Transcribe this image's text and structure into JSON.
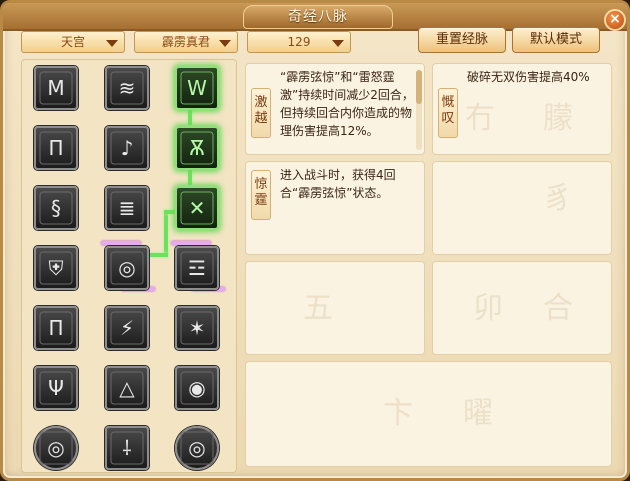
{
  "window": {
    "title": "奇经八脉",
    "close_label": "×"
  },
  "filters": {
    "faction": "天宫",
    "school": "霹雳真君",
    "level": "129"
  },
  "buttons": {
    "reset": "重置经脉",
    "default": "默认模式"
  },
  "skills": [
    {
      "name": "激越",
      "desc": "“霹雳弦惊”和“雷怒霆激”持续时间减少2回合，但持续回合内你造成的物理伤害提高12%。"
    },
    {
      "name": "慨叹",
      "desc": "破碎无双伤害提高40%"
    },
    {
      "name": "惊霆",
      "desc": "进入战斗时，获得4回合“霹雳弦惊”状态。"
    }
  ],
  "colors": {
    "accent": "#b98a45",
    "active_glow": "#6ed95a",
    "chain": "#e6a9f2"
  },
  "icons": [
    "lightning-icon",
    "cloud-icon",
    "claw-icon",
    "pillar-icon",
    "music-icon",
    "demon-icon",
    "swirl-icon",
    "scroll-icon",
    "swords-icon",
    "shield-icon",
    "eyes-icon",
    "flame-icon",
    "gate-icon",
    "crack-icon",
    "burst-icon",
    "helmet-icon",
    "arrow-icon",
    "glare-icon",
    "orb-icon",
    "rune-icon",
    "orb-icon"
  ]
}
